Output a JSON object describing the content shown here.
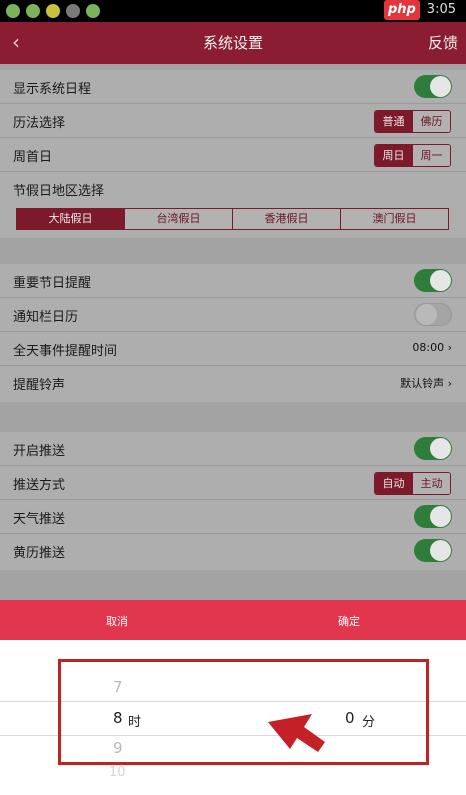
{
  "status": {
    "time": "3:05",
    "watermark": "php"
  },
  "nav": {
    "title": "系统设置",
    "back_icon": "chevron-left-icon",
    "feedback": "反馈"
  },
  "settings": {
    "show_system_schedule": {
      "label": "显示系统日程",
      "on": true
    },
    "calendar_select": {
      "label": "历法选择",
      "options": [
        "普通",
        "佛历"
      ],
      "selected": "普通"
    },
    "week_start": {
      "label": "周首日",
      "options": [
        "周日",
        "周一"
      ],
      "selected": "周日"
    },
    "holiday_region": {
      "label": "节假日地区选择",
      "options": [
        "大陆假日",
        "台湾假日",
        "香港假日",
        "澳门假日"
      ],
      "selected": "大陆假日"
    },
    "important_holiday_reminder": {
      "label": "重要节日提醒",
      "on": true
    },
    "notification_calendar": {
      "label": "通知栏日历",
      "on": false
    },
    "allday_reminder_time": {
      "label": "全天事件提醒时间",
      "value": "08:00"
    },
    "reminder_ringtone": {
      "label": "提醒铃声",
      "value": "默认铃声"
    },
    "enable_push": {
      "label": "开启推送",
      "on": true
    },
    "push_method": {
      "label": "推送方式",
      "options": [
        "自动",
        "主动"
      ],
      "selected": "自动"
    },
    "weather_push": {
      "label": "天气推送",
      "on": true
    },
    "almanac_push": {
      "label": "黄历推送",
      "on": true
    }
  },
  "picker": {
    "cancel": "取消",
    "confirm": "确定",
    "hours": [
      "7",
      "8",
      "9",
      "10"
    ],
    "hour_selected": "8",
    "hour_unit": "时",
    "minute_selected": "0",
    "minute_unit": "分"
  }
}
